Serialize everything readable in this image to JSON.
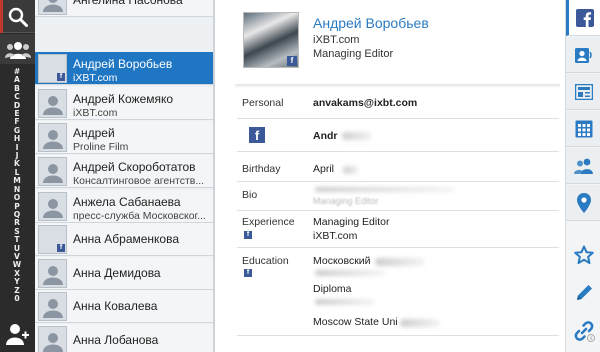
{
  "alphabet": [
    "#",
    "A",
    "B",
    "C",
    "D",
    "E",
    "F",
    "G",
    "H",
    "I",
    "J",
    "K",
    "L",
    "M",
    "N",
    "O",
    "P",
    "Q",
    "R",
    "S",
    "T",
    "U",
    "V",
    "W",
    "X",
    "Y",
    "Z",
    "0"
  ],
  "contacts": [
    {
      "name": "Ангелина Насонова",
      "sub": ""
    },
    {
      "name": "Андрей Воробьев",
      "sub": "iXBT.com",
      "selected": true
    },
    {
      "name": "Андрей Кожемяко",
      "sub": "iXBT.com"
    },
    {
      "name": "Андрей",
      "sub": "Proline Film"
    },
    {
      "name": "Андрей Скороботатов",
      "sub": "Консалтинговое агентств..."
    },
    {
      "name": "Анжела Сабанаева",
      "sub": "пресс-служба Московског..."
    },
    {
      "name": "Анна Абраменкова",
      "sub": ""
    },
    {
      "name": "Анна Демидова",
      "sub": ""
    },
    {
      "name": "Анна Ковалева",
      "sub": ""
    },
    {
      "name": "Анна Лобанова",
      "sub": ""
    }
  ],
  "detail": {
    "name": "Андрей Воробьев",
    "company": "iXBT.com",
    "title": "Managing Editor",
    "fields": {
      "personal_label": "Personal",
      "personal_value": "anvakams@ixbt.com",
      "facebook_value": "Andr",
      "birthday_label": "Birthday",
      "birthday_value": "April",
      "bio_label": "Bio",
      "bio_value": "Managing Editor",
      "experience_label": "Experience",
      "experience_title": "Managing Editor",
      "experience_company": "iXBT.com",
      "education_label": "Education",
      "education_1": "Московский",
      "education_2": "Diploma",
      "education_3": "Moscow State Uni"
    }
  },
  "colors": {
    "accent": "#2a7bc1",
    "selected_row": "#1f76c2",
    "facebook": "#3b5998",
    "rail": "#2b2b2b"
  },
  "icons": {
    "rail": [
      "search-icon",
      "groups-icon",
      "add-person-icon"
    ],
    "right_tabs": [
      "facebook-icon",
      "contact-card-icon",
      "news-icon",
      "calendar-icon",
      "shared-contacts-icon",
      "location-icon"
    ],
    "right_actions": [
      "star-icon",
      "edit-icon",
      "link-icon"
    ]
  }
}
